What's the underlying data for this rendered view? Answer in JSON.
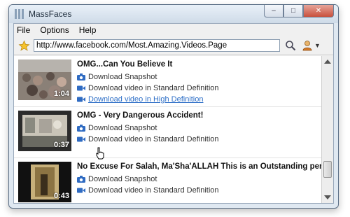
{
  "window": {
    "title": "MassFaces"
  },
  "caption_buttons": {
    "minimize": "–",
    "maximize": "□",
    "close": "✕"
  },
  "menu": [
    "File",
    "Options",
    "Help"
  ],
  "urlbar": {
    "url": "http://www.facebook.com/Most.Amazing.Videos.Page",
    "user_arrow": "▼"
  },
  "videos": [
    {
      "title": "OMG...Can You Believe It",
      "duration": "1:04",
      "actions": [
        "Download Snapshot",
        "Download video in Standard Definition",
        "Download video in High Definition"
      ]
    },
    {
      "title": "OMG - Very Dangerous Accident!",
      "duration": "0:37",
      "actions": [
        "Download Snapshot",
        "Download video in Standard Definition"
      ]
    },
    {
      "title": "No Excuse For Salah, Ma'Sha'ALLAH  This is an Outstanding person, I ...",
      "duration": "0:43",
      "actions": [
        "Download Snapshot",
        "Download video in Standard Definition"
      ]
    }
  ],
  "icons": {
    "favorite": "star-icon",
    "search": "magnifier-icon",
    "user": "user-icon",
    "snapshot": "camera-icon",
    "video": "video-camera-icon"
  }
}
